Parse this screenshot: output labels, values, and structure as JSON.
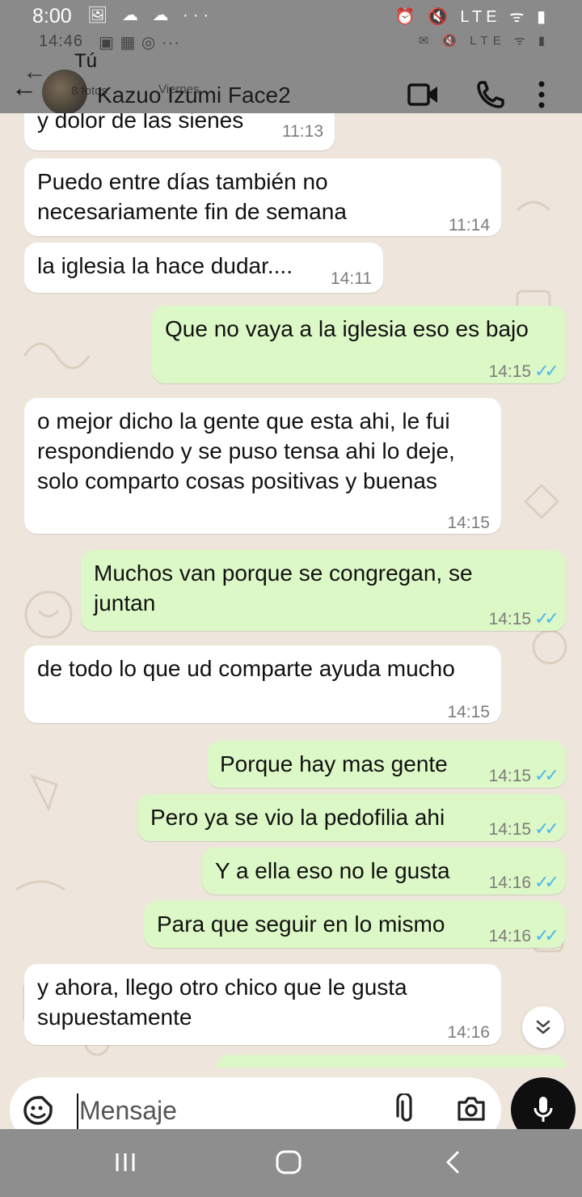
{
  "status_bar": {
    "time": "8:00",
    "left_icons": "🖼 ☁ ☁ ···",
    "right_icons": "⏰ 🔇 LTE ᯤ ▮"
  },
  "ghost_status": {
    "time": "14:46",
    "icons": "▣ ▦ ◎ ···",
    "right_icons": "✉ 🔇 LTE ᯤ ▮"
  },
  "header": {
    "ghost_label": "Tú",
    "ghost_subtitle": "8 fotos",
    "ghost_subtitle_right": "Viernes",
    "contact_name": "Kazuo Izumi Face2",
    "icons": [
      "back-arrow",
      "video-call",
      "voice-call",
      "more-menu"
    ]
  },
  "messages": [
    {
      "dir": "in",
      "text": "y dolor de las sienes",
      "time": "11:13",
      "read": false
    },
    {
      "dir": "in",
      "text": "Puedo entre días también no\nnecesariamente fin de semana",
      "time": "11:14",
      "read": false
    },
    {
      "dir": "in",
      "text": "la iglesia la hace dudar....",
      "time": "14:11",
      "read": false
    },
    {
      "dir": "out",
      "text": "Que no vaya a la iglesia eso es bajo",
      "time": "14:15",
      "read": true
    },
    {
      "dir": "in",
      "text": "o mejor dicho la gente que esta ahi, le fui\nrespondiendo y se puso tensa ahi lo deje,\nsolo comparto cosas positivas y buenas",
      "time": "14:15",
      "read": false
    },
    {
      "dir": "out",
      "text": "Muchos van porque se congregan, se\njuntan",
      "time": "14:15",
      "read": true
    },
    {
      "dir": "in",
      "text": "de todo lo que ud comparte ayuda mucho",
      "time": "14:15",
      "read": false
    },
    {
      "dir": "out",
      "text": "Porque hay mas gente",
      "time": "14:15",
      "read": true
    },
    {
      "dir": "out",
      "text": "Pero ya se vio la pedofilia ahi",
      "time": "14:15",
      "read": true
    },
    {
      "dir": "out",
      "text": "Y a ella eso no le gusta",
      "time": "14:16",
      "read": true
    },
    {
      "dir": "out",
      "text": "Para que seguir en lo mismo",
      "time": "14:16",
      "read": true
    },
    {
      "dir": "in",
      "text": "y ahora, llego otro chico que le gusta\nsupuestamente",
      "time": "14:16",
      "read": false
    }
  ],
  "composer": {
    "placeholder": "Mensaje"
  },
  "colors": {
    "incoming_bubble": "#ffffff",
    "outgoing_bubble": "#dcf8c6",
    "read_ticks": "#4fb6ec",
    "chat_background": "#eee6dc"
  }
}
